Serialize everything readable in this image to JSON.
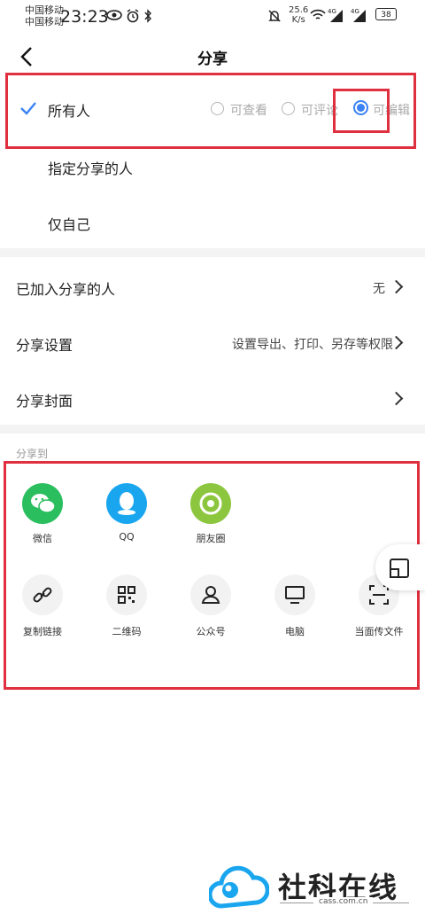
{
  "status_bar": {
    "carrier_1": "中国移动",
    "carrier_2": "中国移动",
    "time": "23:23",
    "speed_value": "25.6",
    "speed_unit": "K/s",
    "net_1": "4G",
    "net_2": "4G",
    "battery": "38"
  },
  "header": {
    "title": "分享",
    "back_icon": "chevron-left-icon"
  },
  "scope": {
    "everyone_label": "所有人",
    "permissions": [
      {
        "label": "可查看",
        "selected": false
      },
      {
        "label": "可评论",
        "selected": false
      },
      {
        "label": "可编辑",
        "selected": true
      }
    ],
    "specified_label": "指定分享的人",
    "self_only_label": "仅自己"
  },
  "settings": {
    "joined": {
      "label": "已加入分享的人",
      "value": "无"
    },
    "share_settings": {
      "label": "分享设置",
      "value": "设置导出、打印、另存等权限"
    },
    "cover": {
      "label": "分享封面"
    }
  },
  "share_to": {
    "section_label": "分享到",
    "row1": [
      {
        "label": "微信",
        "icon": "wechat-icon",
        "color": "#2bbe5f"
      },
      {
        "label": "QQ",
        "icon": "qq-icon",
        "color": "#1aa6ef"
      },
      {
        "label": "朋友圈",
        "icon": "moments-icon",
        "color": "#8cc63f"
      }
    ],
    "row2": [
      {
        "label": "复制链接",
        "icon": "link-icon"
      },
      {
        "label": "二维码",
        "icon": "qrcode-icon"
      },
      {
        "label": "公众号",
        "icon": "person-icon"
      },
      {
        "label": "电脑",
        "icon": "monitor-icon"
      },
      {
        "label": "当面传文件",
        "icon": "scan-icon"
      }
    ]
  },
  "watermark": {
    "brand": "社科在线",
    "url": "cass.com.cn"
  },
  "colors": {
    "accent": "#3b82f6",
    "highlight": "#e02f3f"
  }
}
